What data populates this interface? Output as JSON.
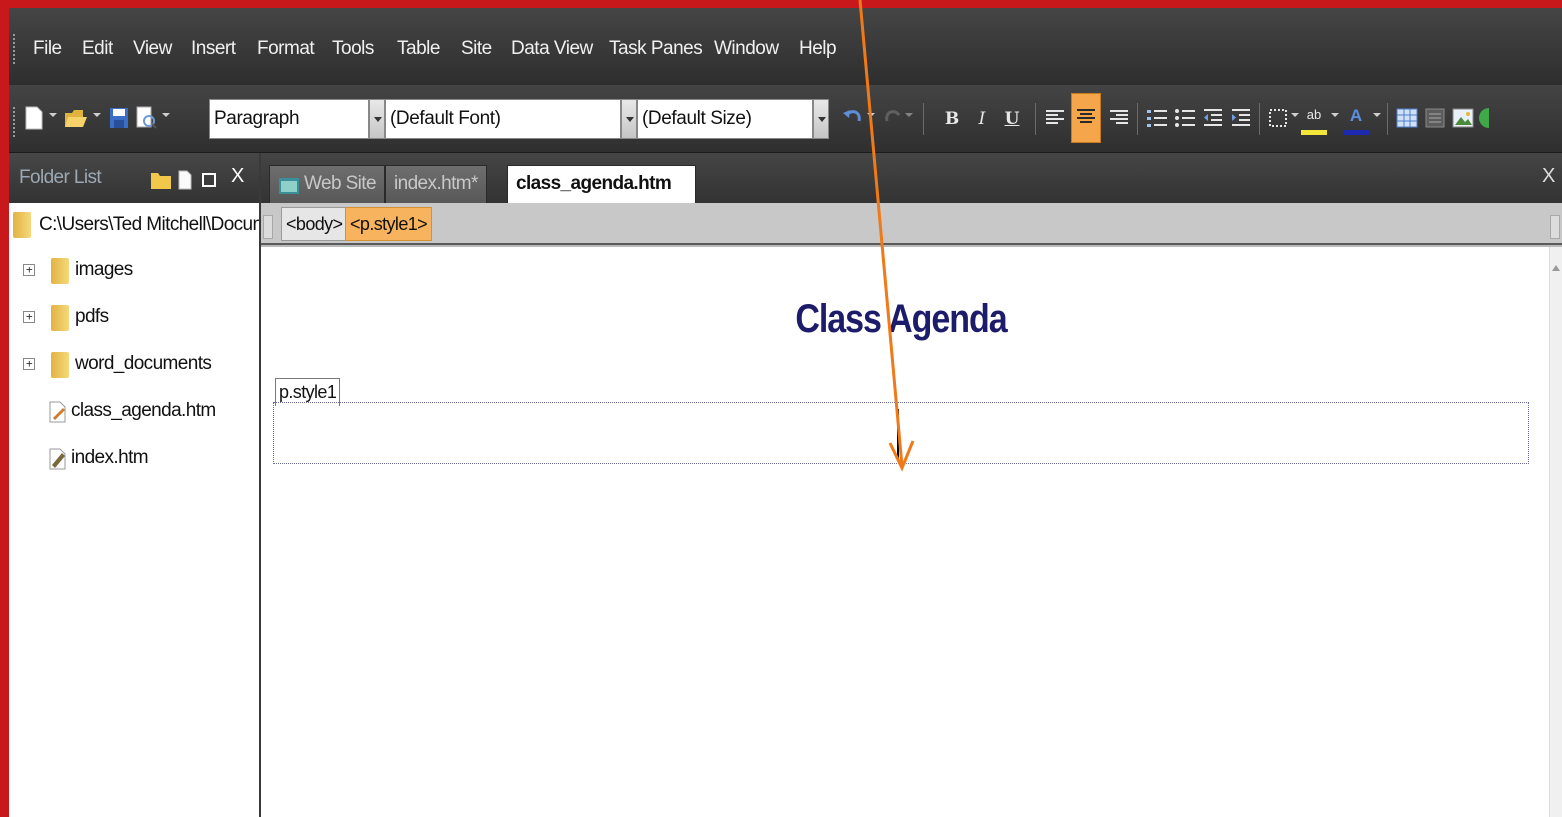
{
  "menu": {
    "items": [
      "File",
      "Edit",
      "View",
      "Insert",
      "Format",
      "Tools",
      "Table",
      "Site",
      "Data View",
      "Task Panes",
      "Window",
      "Help"
    ]
  },
  "toolbar": {
    "style_value": "Paragraph",
    "font_value": "(Default Font)",
    "size_value": "(Default Size)",
    "bold_label": "B",
    "italic_label": "I",
    "underline_label": "U",
    "highlight_label": "ab",
    "font_color_label": "A"
  },
  "folder_list": {
    "title": "Folder List",
    "close_label": "X",
    "root_path": "C:\\Users\\Ted Mitchell\\Documents",
    "items": [
      {
        "label": "images",
        "type": "folder"
      },
      {
        "label": "pdfs",
        "type": "folder"
      },
      {
        "label": "word_documents",
        "type": "folder"
      },
      {
        "label": "class_agenda.htm",
        "type": "file"
      },
      {
        "label": "index.htm",
        "type": "file"
      }
    ]
  },
  "tabs": [
    {
      "label": "Web Site",
      "active": false
    },
    {
      "label": "index.htm*",
      "active": false
    },
    {
      "label": "class_agenda.htm",
      "active": true
    }
  ],
  "doc_close_label": "X",
  "quick_tags": [
    "<body>",
    "<p.style1>"
  ],
  "document": {
    "heading": "Class Agenda",
    "style_label": "p.style1"
  },
  "colors": {
    "frame_border": "#c8181b",
    "arrow": "#f07a1a",
    "heading": "#1c1c6a",
    "selected_tag": "#f7b35e"
  }
}
